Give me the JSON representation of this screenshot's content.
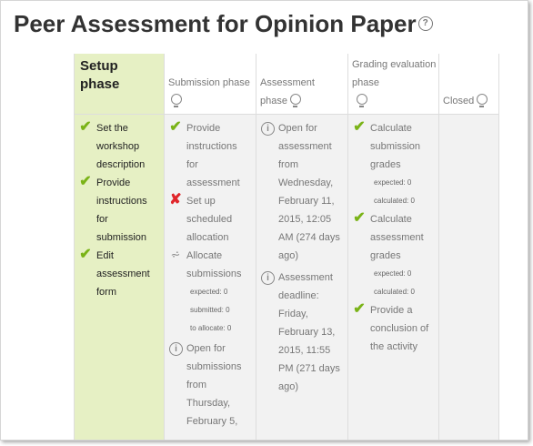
{
  "page": {
    "title": "Peer Assessment for Opinion Paper",
    "help_icon": "question-circle-icon"
  },
  "phases": {
    "setup": {
      "label": "Setup phase",
      "tasks": [
        {
          "status": "done",
          "text": "Set the workshop description"
        },
        {
          "status": "done",
          "text": "Provide instructions for submission"
        },
        {
          "status": "done",
          "text": "Edit assessment form"
        }
      ]
    },
    "submission": {
      "label": "Submission phase",
      "tasks": [
        {
          "status": "done",
          "text": "Provide instructions for assessment"
        },
        {
          "status": "fail",
          "text": "Set up scheduled allocation"
        },
        {
          "status": "info",
          "text": "Allocate submissions"
        },
        {
          "status": "info",
          "text": "Open for submissions from Thursday, February 5,"
        }
      ],
      "allocate_expected": "expected: 0",
      "allocate_submitted": "submitted: 0",
      "allocate_to_allocate": "to allocate: 0"
    },
    "assessment": {
      "label": "Assessment phase",
      "tasks": [
        {
          "status": "info",
          "text": "Open for assessment from Wednesday, February 11, 2015, 12:05 AM (274 days ago)"
        },
        {
          "status": "info",
          "text": "Assessment deadline: Friday, February 13, 2015, 11:55 PM (271 days ago)"
        }
      ]
    },
    "grading": {
      "label": "Grading evaluation phase",
      "tasks": [
        {
          "status": "done",
          "text": "Calculate submission grades"
        },
        {
          "status": "done",
          "text": "Calculate assessment grades"
        },
        {
          "status": "done",
          "text": "Provide a conclusion of the activity"
        }
      ],
      "sub_expected_1": "expected: 0",
      "sub_calculated_1": "calculated: 0",
      "sub_expected_2": "expected: 0",
      "sub_calculated_2": "calculated: 0"
    },
    "closed": {
      "label": "Closed"
    }
  },
  "icons": {
    "check": "check-icon",
    "cross": "cross-icon",
    "info": "info-circle-icon",
    "schedule": "scheduled-allocation-icon",
    "bulb": "lightbulb-icon"
  },
  "colors": {
    "active_phase_bg": "#e6f0c4",
    "inactive_phase_bg": "#f2f2f2",
    "check": "#7ab317",
    "cross": "#e0262b"
  }
}
